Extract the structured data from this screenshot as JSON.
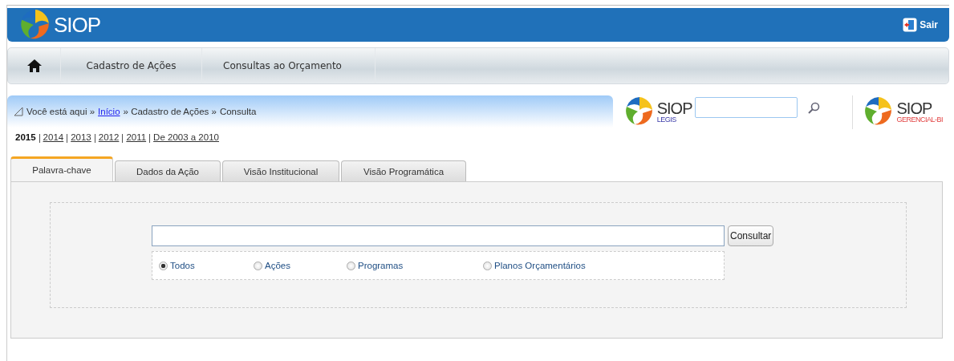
{
  "header": {
    "logo_text": "SIOP",
    "logout": "Sair"
  },
  "menu": {
    "items": [
      {
        "label": "Cadastro de Ações"
      },
      {
        "label": "Consultas ao Orçamento"
      }
    ]
  },
  "breadcrumb": {
    "prefix": "Você está aqui »",
    "items": [
      {
        "label": "Início",
        "link": true
      },
      {
        "label": "» Cadastro de Ações »",
        "link": false
      },
      {
        "label": "Consulta",
        "link": false
      }
    ]
  },
  "apps": [
    {
      "title": "SIOP",
      "subtitle": "LEGIS",
      "kind": "legis"
    },
    {
      "title": "SIOP",
      "subtitle": "GERENCIAL-BI",
      "kind": "bi"
    }
  ],
  "years": [
    {
      "label": "2015",
      "selected": true
    },
    {
      "label": "2014",
      "selected": false
    },
    {
      "label": "2013",
      "selected": false
    },
    {
      "label": "2012",
      "selected": false
    },
    {
      "label": "2011",
      "selected": false
    },
    {
      "label": "De 2003 a 2010",
      "selected": false
    }
  ],
  "tabs": [
    {
      "label": "Palavra-chave",
      "selected": true
    },
    {
      "label": "Dados da Ação",
      "selected": false
    },
    {
      "label": "Visão Institucional",
      "selected": false
    },
    {
      "label": "Visão Programática",
      "selected": false
    }
  ],
  "search": {
    "button": "Consultar"
  },
  "filters": [
    {
      "label": "Todos",
      "selected": true
    },
    {
      "label": "Ações",
      "selected": false
    },
    {
      "label": "Programas",
      "selected": false
    },
    {
      "label": "Planos Orçamentários",
      "selected": false
    }
  ]
}
